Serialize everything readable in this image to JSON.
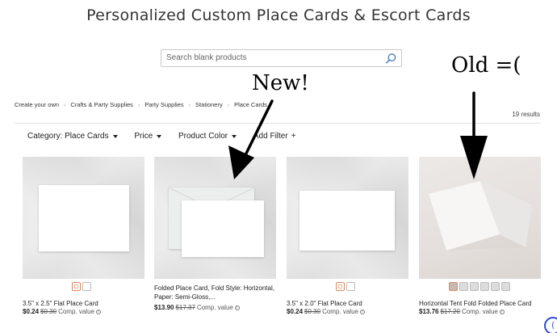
{
  "page": {
    "title": "Personalized Custom Place Cards & Escort Cards",
    "search_placeholder": "Search blank products"
  },
  "annotations": {
    "new_label": "New!",
    "old_label": "Old =("
  },
  "breadcrumb": [
    "Create your own",
    "Crafts & Party Supplies",
    "Party Supplies",
    "Stationery",
    "Place Cards"
  ],
  "results_count": "19 results",
  "filters": [
    {
      "label": "Category: Place Cards",
      "icon": "caret-down"
    },
    {
      "label": "Price",
      "icon": "caret-down"
    },
    {
      "label": "Product Color",
      "icon": "caret-down"
    },
    {
      "label": "Add Filter",
      "icon": "plus"
    }
  ],
  "products": [
    {
      "title": "3.5\" x 2.5\" Flat Place Card",
      "price": "$0.24",
      "orig_price": "$0.30",
      "comp": "Comp. value"
    },
    {
      "title": "Folded Place Card, Fold Style: Horizontal, Paper: Semi-Gloss,...",
      "price": "$13.90",
      "orig_price": "$17.37",
      "comp": "Comp. value"
    },
    {
      "title": "3.5\" x 2.0\" Flat Place Card",
      "price": "$0.24",
      "orig_price": "$0.30",
      "comp": "Comp. value"
    },
    {
      "title": "Horizontal Tent Fold Folded Place Card",
      "price": "$13.76",
      "orig_price": "$17.20",
      "comp": "Comp. value"
    }
  ],
  "info_glyph": "i",
  "chat_glyph": "(",
  "colors": {
    "accent_swatch": "#d88a5e",
    "chat": "#2b4bd1"
  }
}
